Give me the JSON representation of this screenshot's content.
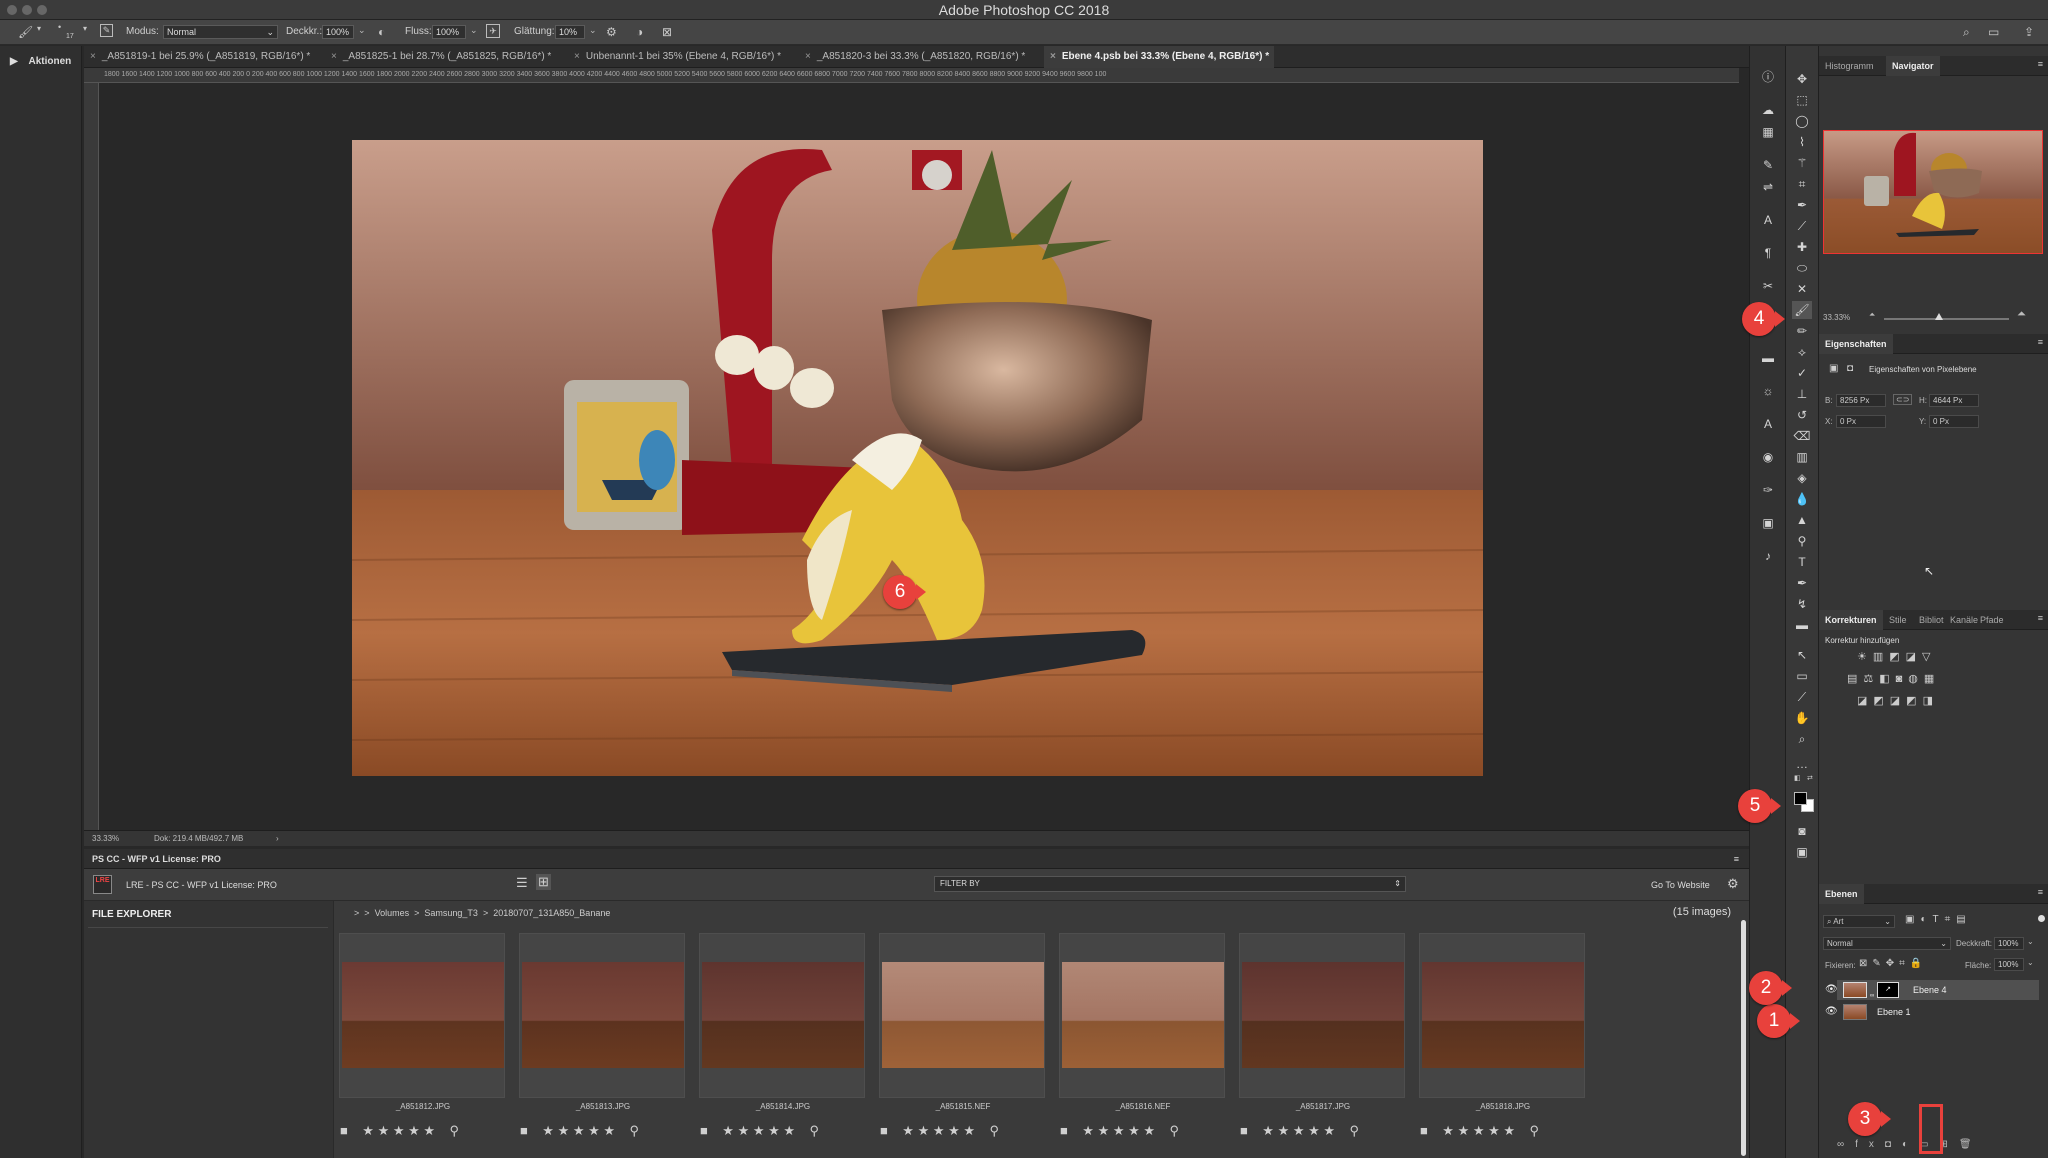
{
  "app": {
    "title": "Adobe Photoshop CC 2018"
  },
  "options_bar": {
    "brush_size": "17",
    "mode_label": "Modus:",
    "mode_value": "Normal",
    "opacity_label": "Deckkr.:",
    "opacity_value": "100%",
    "flow_label": "Fluss:",
    "flow_value": "100%",
    "smoothing_label": "Glättung:",
    "smoothing_value": "10%"
  },
  "left_panel": {
    "actions_label": "Aktionen"
  },
  "tabs": [
    {
      "label": "_A851819-1 bei 25.9% (_A851819, RGB/16*) *"
    },
    {
      "label": "_A851825-1 bei 28.7% (_A851825, RGB/16*) *"
    },
    {
      "label": "Unbenannt-1 bei 35% (Ebene 4, RGB/16*) *"
    },
    {
      "label": "_A851820-3 bei 33.3% (_A851820, RGB/16*) *"
    },
    {
      "label": "Ebene 4.psb bei 33.3% (Ebene 4, RGB/16*) *"
    }
  ],
  "ruler_ticks": "1800  1600  1400  1200  1000   800   600   400   200     0    200   400   600   800  1000  1200  1400  1600  1800  2000  2200  2400  2600  2800  3000  3200  3400  3600  3800  4000  4200  4400  4600  4800  5000  5200  5400  5600  5800  6000  6200  6400  6600  6800  7000  7200  7400  7600  7800  8000  8200  8400  8600  8800  9000  9200  9400  9600  9800  100",
  "status": {
    "zoom": "33.33%",
    "doc": "Dok: 219.4 MB/492.7 MB"
  },
  "extension": {
    "header": "PS CC - WFP v1 License: PRO",
    "logo": "LRE",
    "license": "LRE - PS CC - WFP v1 License: PRO",
    "filter_label": "FILTER BY",
    "website_label": "Go To Website",
    "explorer_title": "FILE EXPLORER",
    "path": [
      ">",
      ">",
      "Volumes",
      ">",
      "Samsung_T3",
      ">",
      "20180707_131A850_Banane"
    ],
    "count": "(15 images)",
    "thumbnails": [
      {
        "name": "_A851812.JPG"
      },
      {
        "name": "_A851813.JPG"
      },
      {
        "name": "_A851814.JPG"
      },
      {
        "name": "_A851815.NEF"
      },
      {
        "name": "_A851816.NEF"
      },
      {
        "name": "_A851817.JPG"
      },
      {
        "name": "_A851818.JPG"
      }
    ]
  },
  "panels": {
    "histogram_tab": "Histogramm",
    "navigator_tab": "Navigator",
    "nav_zoom": "33.33%",
    "properties_title": "Eigenschaften",
    "properties_sub": "Eigenschaften von Pixelebene",
    "w_label": "B:",
    "w_value": "8256 Px",
    "h_label": "H:",
    "h_value": "4644 Px",
    "x_label": "X:",
    "x_value": "0 Px",
    "y_label": "Y:",
    "y_value": "0 Px",
    "adj_tabs": [
      "Korrekturen",
      "Stile",
      "Bibliot",
      "Kanäle",
      "Pfade"
    ],
    "adj_add": "Korrektur hinzufügen",
    "layers_title": "Ebenen",
    "layers_kind": "Art",
    "layers_mode": "Normal",
    "layers_opacity_label": "Deckkraft:",
    "layers_opacity_value": "100%",
    "layers_lock_label": "Fixieren:",
    "layers_fill_label": "Fläche:",
    "layers_fill_value": "100%",
    "layers": [
      {
        "name": "Ebene 4"
      },
      {
        "name": "Ebene 1"
      }
    ]
  },
  "callouts": [
    "1",
    "2",
    "3",
    "4",
    "5",
    "6"
  ],
  "colors": {
    "callout": "#e8413c",
    "bg": "#282828",
    "panel": "#353535"
  }
}
